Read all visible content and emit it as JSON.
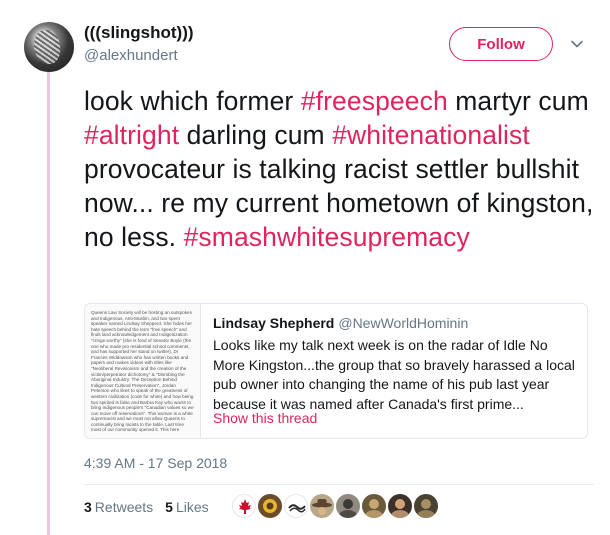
{
  "author": {
    "display_name": "(((slingshot)))",
    "handle": "@alexhundert",
    "avatar_icon": "grayscale-sculpture-avatar"
  },
  "follow": {
    "label": "Follow",
    "color": "#e0245e"
  },
  "menu": {
    "icon": "chevron-down-icon"
  },
  "tweet": {
    "segments": [
      {
        "text": "look which former ",
        "type": "text"
      },
      {
        "text": "#freespeech",
        "type": "hashtag"
      },
      {
        "text": " martyr cum ",
        "type": "text"
      },
      {
        "text": "#altright",
        "type": "hashtag"
      },
      {
        "text": " darling cum ",
        "type": "text"
      },
      {
        "text": "#whitenationalist",
        "type": "hashtag"
      },
      {
        "text": " provocateur is talking racist settler bullshit now... re my current hometown of kingston, no less. ",
        "type": "text"
      },
      {
        "text": "#smashwhitesupremacy",
        "type": "hashtag"
      }
    ]
  },
  "quote": {
    "name": "Lindsay Shepherd",
    "handle": "@NewWorldHominin",
    "body": "Looks like my talk next week is on the radar of Idle No More Kingston...the group that so bravely harassed a local pub owner into changing the name of his pub last year because it was named after Canada's first prime...",
    "show_thread": "Show this thread",
    "thumbnail_text": "Queens Law Society will be hosting an outspoken and Indigenous, Anti-Muslim, and two spent speaker named Lindsay Shepperd. She hides her hate speech behind the term \"free speech\" and finds land acknowledgement and Indigenization \"cringe worthy\" (she is fond of Senator Boyle (the one who made pro residential school comments, and has supported her stand on twitter), Dr Frances Widdowson who has written books and papers and makes videos with titles like \"Neoliberal Revisionism and the creation of the victim/perpetrator dichotomy\" & \"Disrobing the Aboriginal Industry: The Deception Behind Indigenous Cultural Preservation\", Jordan Peterson who likes to speak of the greatness of western civilization (code for white) and how being two spirited is false and Barbra Kay who wants to bring Indigenous people's \"Canadian values so we can move off reservations\". This woman is a white supremacist and we must not allow Queens to continually bring racists to the table. Last time most of our community opened it. This here"
  },
  "meta": {
    "timestamp": "4:39 AM - 17 Sep 2018"
  },
  "stats": {
    "retweets_count": "3",
    "retweets_label": "Retweets",
    "likes_count": "5",
    "likes_label": "Likes"
  },
  "likers": [
    {
      "icon": "red-maple-leaf-avatar",
      "bg": "#ffffff",
      "fg": "#c8102e"
    },
    {
      "icon": "sunflower-avatar",
      "bg": "#6b4b2a",
      "fg": "#e5b730"
    },
    {
      "icon": "stripes-logo-avatar",
      "bg": "#ffffff",
      "fg": "#2b2b2b"
    },
    {
      "icon": "cowboy-hat-avatar",
      "bg": "#b9a78a",
      "fg": "#5c4630"
    },
    {
      "icon": "cat-avatar",
      "bg": "#8f8a80",
      "fg": "#3c3a35"
    },
    {
      "icon": "person-photo-avatar",
      "bg": "#6a5a3c",
      "fg": "#c9a571"
    },
    {
      "icon": "person-photo-avatar",
      "bg": "#3b3129",
      "fg": "#d3a47a"
    },
    {
      "icon": "person-photo-avatar",
      "bg": "#4a4230",
      "fg": "#a88f63"
    }
  ],
  "colors": {
    "accent": "#e0245e",
    "secondary_text": "#657786",
    "thread_line": "#e9c7e0"
  }
}
